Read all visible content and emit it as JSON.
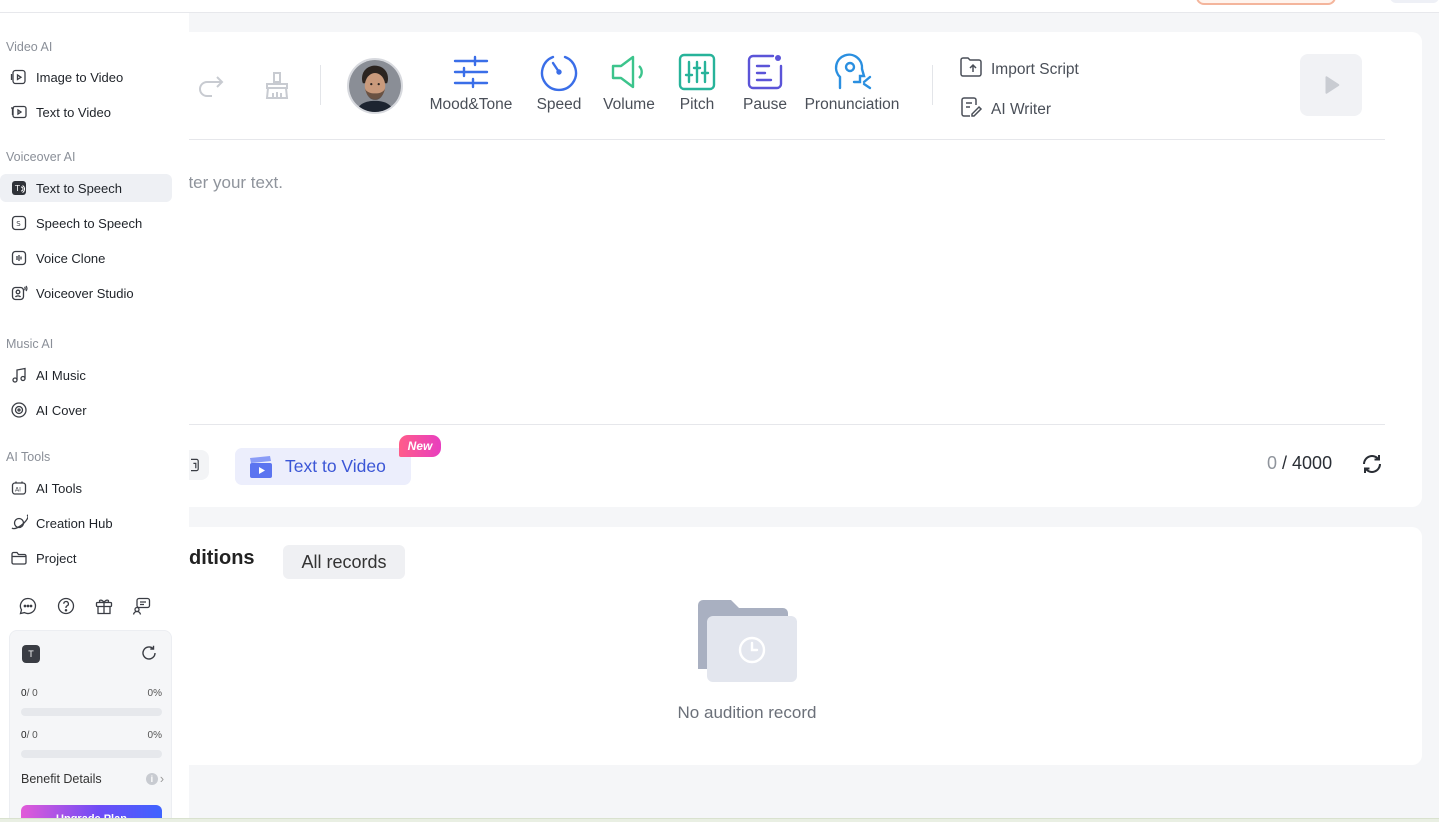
{
  "sidebar": {
    "groups": [
      {
        "title": "Video AI",
        "items": [
          {
            "label": "Image to Video",
            "icon": "image-to-video-icon"
          },
          {
            "label": "Text to Video",
            "icon": "text-to-video-icon"
          }
        ]
      },
      {
        "title": "Voiceover AI",
        "items": [
          {
            "label": "Text to Speech",
            "icon": "text-to-speech-icon",
            "active": true
          },
          {
            "label": "Speech to Speech",
            "icon": "speech-to-speech-icon"
          },
          {
            "label": "Voice Clone",
            "icon": "voice-clone-icon"
          },
          {
            "label": "Voiceover Studio",
            "icon": "voiceover-studio-icon"
          }
        ]
      },
      {
        "title": "Music AI",
        "items": [
          {
            "label": "AI Music",
            "icon": "music-note-icon"
          },
          {
            "label": "AI Cover",
            "icon": "disc-icon"
          }
        ]
      },
      {
        "title": "AI Tools",
        "items": [
          {
            "label": "AI Tools",
            "icon": "ai-tools-icon"
          },
          {
            "label": "Creation Hub",
            "icon": "planet-icon"
          },
          {
            "label": "Project",
            "icon": "folder-icon"
          }
        ]
      }
    ],
    "utilities": [
      "chat-icon",
      "help-icon",
      "gift-icon",
      "feedback-icon"
    ],
    "quota": {
      "icon_text": "T",
      "rows": [
        {
          "used": "0",
          "total": "/ 0",
          "percent": "0%",
          "fraction": 0
        },
        {
          "used": "0",
          "total": "/ 0",
          "percent": "0%",
          "fraction": 0
        }
      ],
      "benefit_label": "Benefit Details",
      "upgrade_label": "Upgrade Plan"
    }
  },
  "toolbar": {
    "tools": [
      {
        "label": "Mood&Tone",
        "icon": "sliders-icon",
        "color": "#3a6ee8"
      },
      {
        "label": "Speed",
        "icon": "speedometer-icon",
        "color": "#3a6ee8"
      },
      {
        "label": "Volume",
        "icon": "volume-icon",
        "color": "#3cc48c"
      },
      {
        "label": "Pitch",
        "icon": "equalizer-icon",
        "color": "#27b39a"
      },
      {
        "label": "Pause",
        "icon": "pause-icon",
        "color": "#5b54d8"
      },
      {
        "label": "Pronunciation",
        "icon": "pronunciation-icon",
        "color": "#2a8fe0"
      }
    ],
    "import_label": "Import Script",
    "writer_label": "AI Writer"
  },
  "editor": {
    "placeholder": "nter your text.",
    "text_to_video_label": "Text to Video",
    "new_badge": "New",
    "char_count": "0",
    "char_limit": "/ 4000"
  },
  "history": {
    "tab_partial": "ditions",
    "tab_all": "All records",
    "empty_text": "No audition record"
  }
}
